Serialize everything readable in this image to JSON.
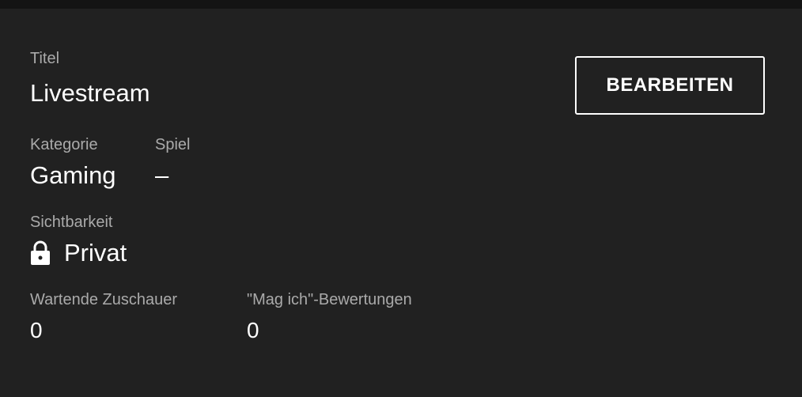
{
  "details": {
    "title_label": "Titel",
    "title_value": "Livestream",
    "category_label": "Kategorie",
    "category_value": "Gaming",
    "game_label": "Spiel",
    "game_value": "–",
    "visibility_label": "Sichtbarkeit",
    "visibility_value": "Privat",
    "visibility_icon": "lock-icon",
    "waiting_viewers_label": "Wartende Zuschauer",
    "waiting_viewers_value": "0",
    "likes_label": "\"Mag ich\"-Bewertungen",
    "likes_value": "0"
  },
  "actions": {
    "edit_label": "BEARBEITEN"
  },
  "colors": {
    "background": "#212121",
    "topbar": "#141414",
    "label": "#aaaaaa",
    "value": "#ffffff"
  }
}
